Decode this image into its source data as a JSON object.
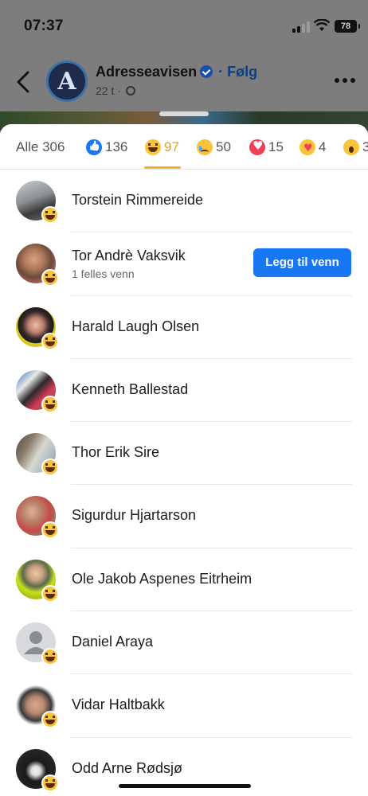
{
  "status_bar": {
    "time": "07:37",
    "battery": "78"
  },
  "post_header": {
    "page_name": "Adresseavisen",
    "follow_label": "· Følg",
    "post_time": "22 t ·"
  },
  "reaction_tabs": [
    {
      "label": "Alle 306",
      "icon": ""
    },
    {
      "label": "136",
      "icon": "like-icon"
    },
    {
      "label": "97",
      "icon": "haha-icon",
      "active": true
    },
    {
      "label": "50",
      "icon": "sad-icon"
    },
    {
      "label": "15",
      "icon": "love-icon"
    },
    {
      "label": "4",
      "icon": "care-icon"
    },
    {
      "label": "3",
      "icon": "wow-icon"
    }
  ],
  "people": [
    {
      "name": "Torstein Rimmereide",
      "reaction": "haha"
    },
    {
      "name": "Tor Andrè Vaksvik",
      "subtitle": "1 felles venn",
      "button": "Legg til venn",
      "reaction": "haha"
    },
    {
      "name": "Harald Laugh Olsen",
      "reaction": "haha"
    },
    {
      "name": "Kenneth Ballestad",
      "reaction": "haha"
    },
    {
      "name": "Thor Erik Sire",
      "reaction": "haha"
    },
    {
      "name": "Sigurdur Hjartarson",
      "reaction": "haha"
    },
    {
      "name": "Ole Jakob Aspenes Eitrheim",
      "reaction": "haha"
    },
    {
      "name": "Daniel Araya",
      "reaction": "haha"
    },
    {
      "name": "Vidar Haltbakk",
      "reaction": "haha"
    },
    {
      "name": "Odd Arne Rødsjø",
      "reaction": "haha"
    }
  ],
  "colors": {
    "accent": "#1877f2",
    "active_tab": "#f0b429"
  }
}
